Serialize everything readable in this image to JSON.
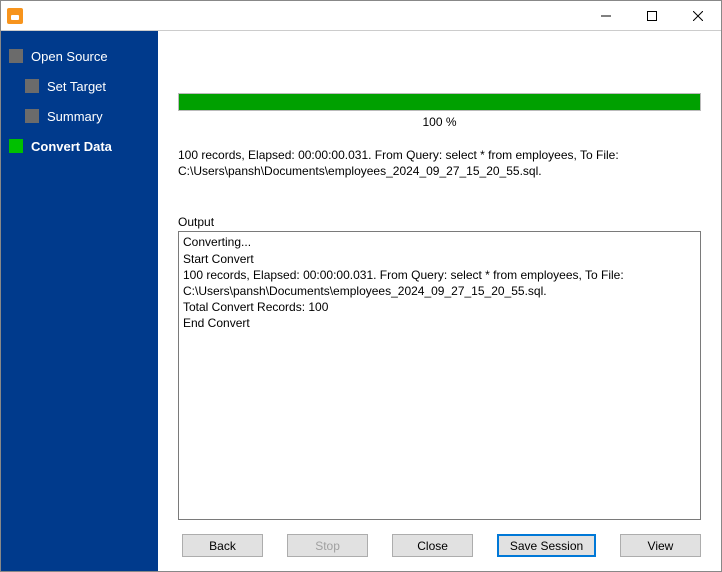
{
  "window": {
    "title": ""
  },
  "sidebar": {
    "items": [
      {
        "label": "Open Source",
        "active": false,
        "indent": false
      },
      {
        "label": "Set Target",
        "active": false,
        "indent": true
      },
      {
        "label": "Summary",
        "active": false,
        "indent": true
      },
      {
        "label": "Convert Data",
        "active": true,
        "indent": false
      }
    ]
  },
  "progress": {
    "percent": 100,
    "label": "100 %"
  },
  "status_text": "100 records,    Elapsed: 00:00:00.031.    From Query: select * from employees,    To File: C:\\Users\\pansh\\Documents\\employees_2024_09_27_15_20_55.sql.",
  "output": {
    "label": "Output",
    "lines": [
      "Converting...",
      "Start Convert",
      "100 records,    Elapsed: 00:00:00.031.    From Query: select * from employees,    To File: C:\\Users\\pansh\\Documents\\employees_2024_09_27_15_20_55.sql.",
      "Total Convert Records: 100",
      "End Convert"
    ]
  },
  "buttons": {
    "back": "Back",
    "stop": "Stop",
    "close": "Close",
    "save": "Save Session",
    "view": "View"
  }
}
